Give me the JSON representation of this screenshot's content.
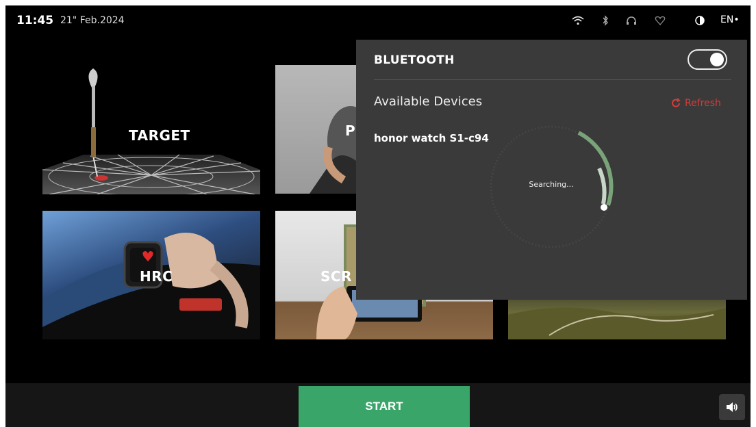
{
  "status": {
    "time": "11:45",
    "date": "21\" Feb.2024",
    "language": "EN•",
    "icons": [
      "wifi-icon",
      "bluetooth-icon",
      "headset-icon",
      "heart-icon",
      "contrast-icon"
    ]
  },
  "tiles": [
    {
      "label": "TARGET"
    },
    {
      "label": "P"
    },
    {
      "label": "HRC"
    },
    {
      "label": "SCR"
    }
  ],
  "bluetooth": {
    "title": "BLUETOOTH",
    "enabled": true,
    "available_label": "Available Devices",
    "refresh_label": "Refresh",
    "devices": [
      "honor watch S1-c94"
    ],
    "status": "Searching..."
  },
  "footer": {
    "start_label": "START"
  },
  "colors": {
    "start": "#3aa569",
    "refresh": "#d83a3a",
    "panel": "#3a3a3a"
  }
}
